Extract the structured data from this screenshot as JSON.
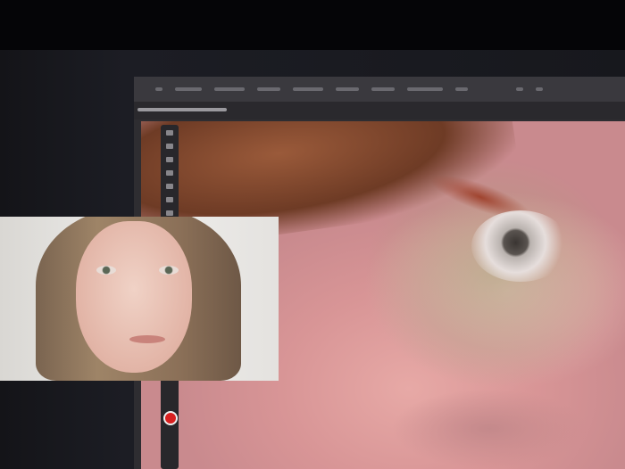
{
  "app": {
    "name": "image-editor"
  },
  "colors": {
    "foreground_swatch": "#d82020",
    "window_bg": "#2e2d31"
  },
  "icons": [
    "move-tool-icon",
    "marquee-tool-icon",
    "lasso-tool-icon",
    "crop-tool-icon",
    "brush-tool-icon"
  ]
}
